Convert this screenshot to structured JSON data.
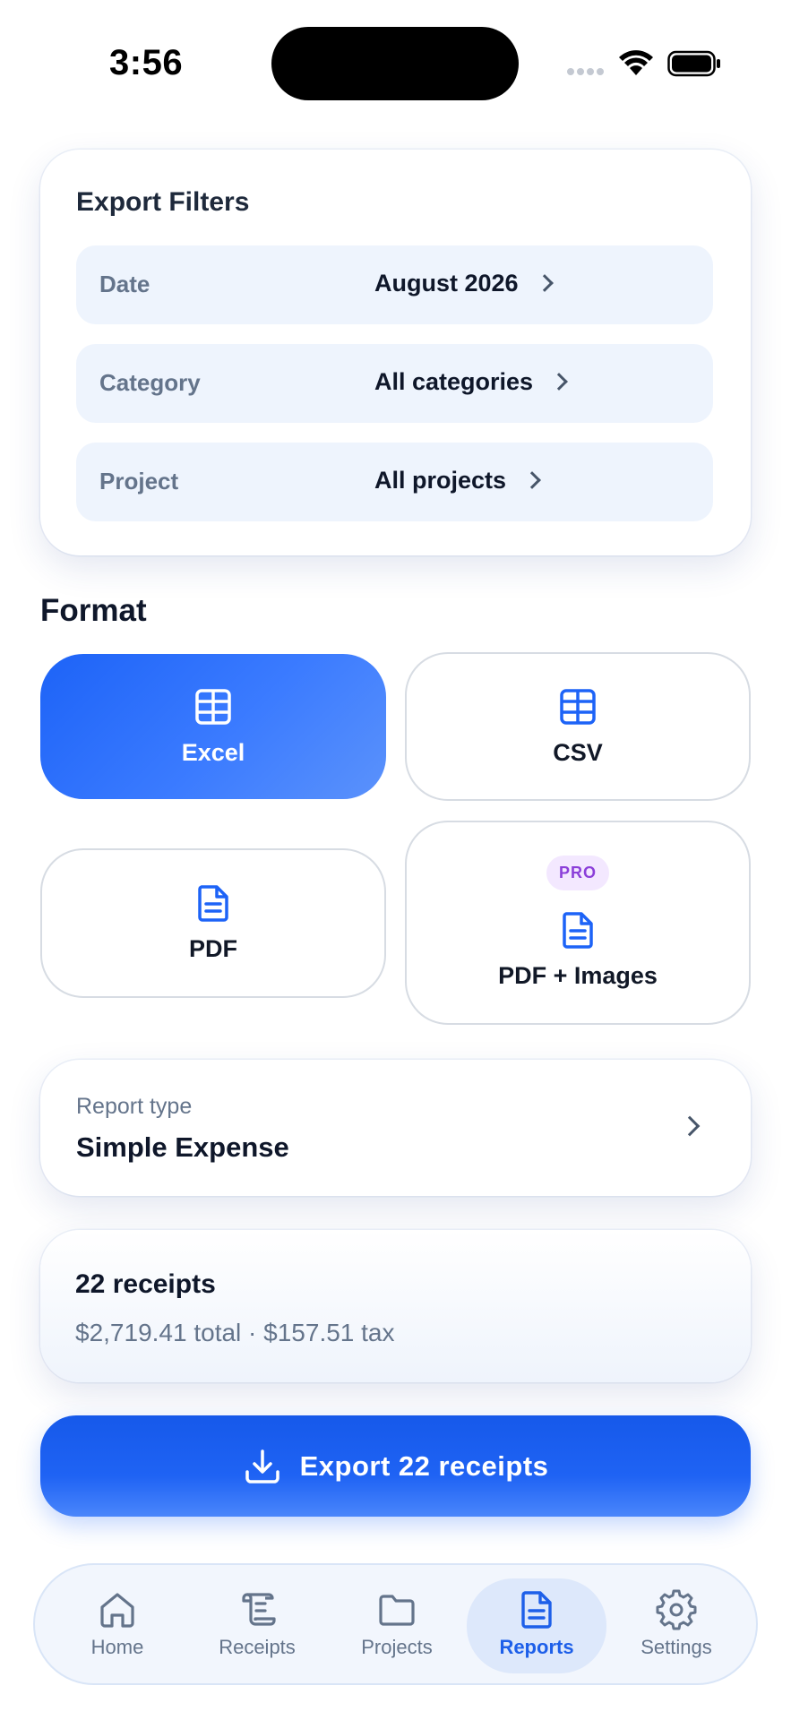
{
  "status_bar": {
    "time": "3:56"
  },
  "filters": {
    "title": "Export Filters",
    "rows": [
      {
        "label": "Date",
        "value": "August 2026"
      },
      {
        "label": "Category",
        "value": "All categories"
      },
      {
        "label": "Project",
        "value": "All projects"
      }
    ]
  },
  "format": {
    "title": "Format",
    "options": [
      {
        "label": "Excel",
        "icon": "table-icon",
        "selected": true
      },
      {
        "label": "CSV",
        "icon": "table-icon",
        "selected": false
      },
      {
        "label": "PDF",
        "icon": "document-icon",
        "selected": false
      },
      {
        "label": "PDF + Images",
        "icon": "document-icon",
        "selected": false,
        "badge": "PRO"
      }
    ]
  },
  "report": {
    "label": "Report type",
    "value": "Simple Expense"
  },
  "summary": {
    "count": "22 receipts",
    "totals": "$2,719.41 total · $157.51 tax"
  },
  "export": {
    "label": "Export 22 receipts",
    "icon": "download-icon"
  },
  "tabs": [
    {
      "label": "Home",
      "icon": "home-icon",
      "active": false
    },
    {
      "label": "Receipts",
      "icon": "scroll-icon",
      "active": false
    },
    {
      "label": "Projects",
      "icon": "folder-icon",
      "active": false
    },
    {
      "label": "Reports",
      "icon": "document-icon",
      "active": true
    },
    {
      "label": "Settings",
      "icon": "gear-icon",
      "active": false
    }
  ],
  "colors": {
    "accent": "#1d63f7",
    "badge_text": "#8b3fd9",
    "muted": "#64748b"
  }
}
